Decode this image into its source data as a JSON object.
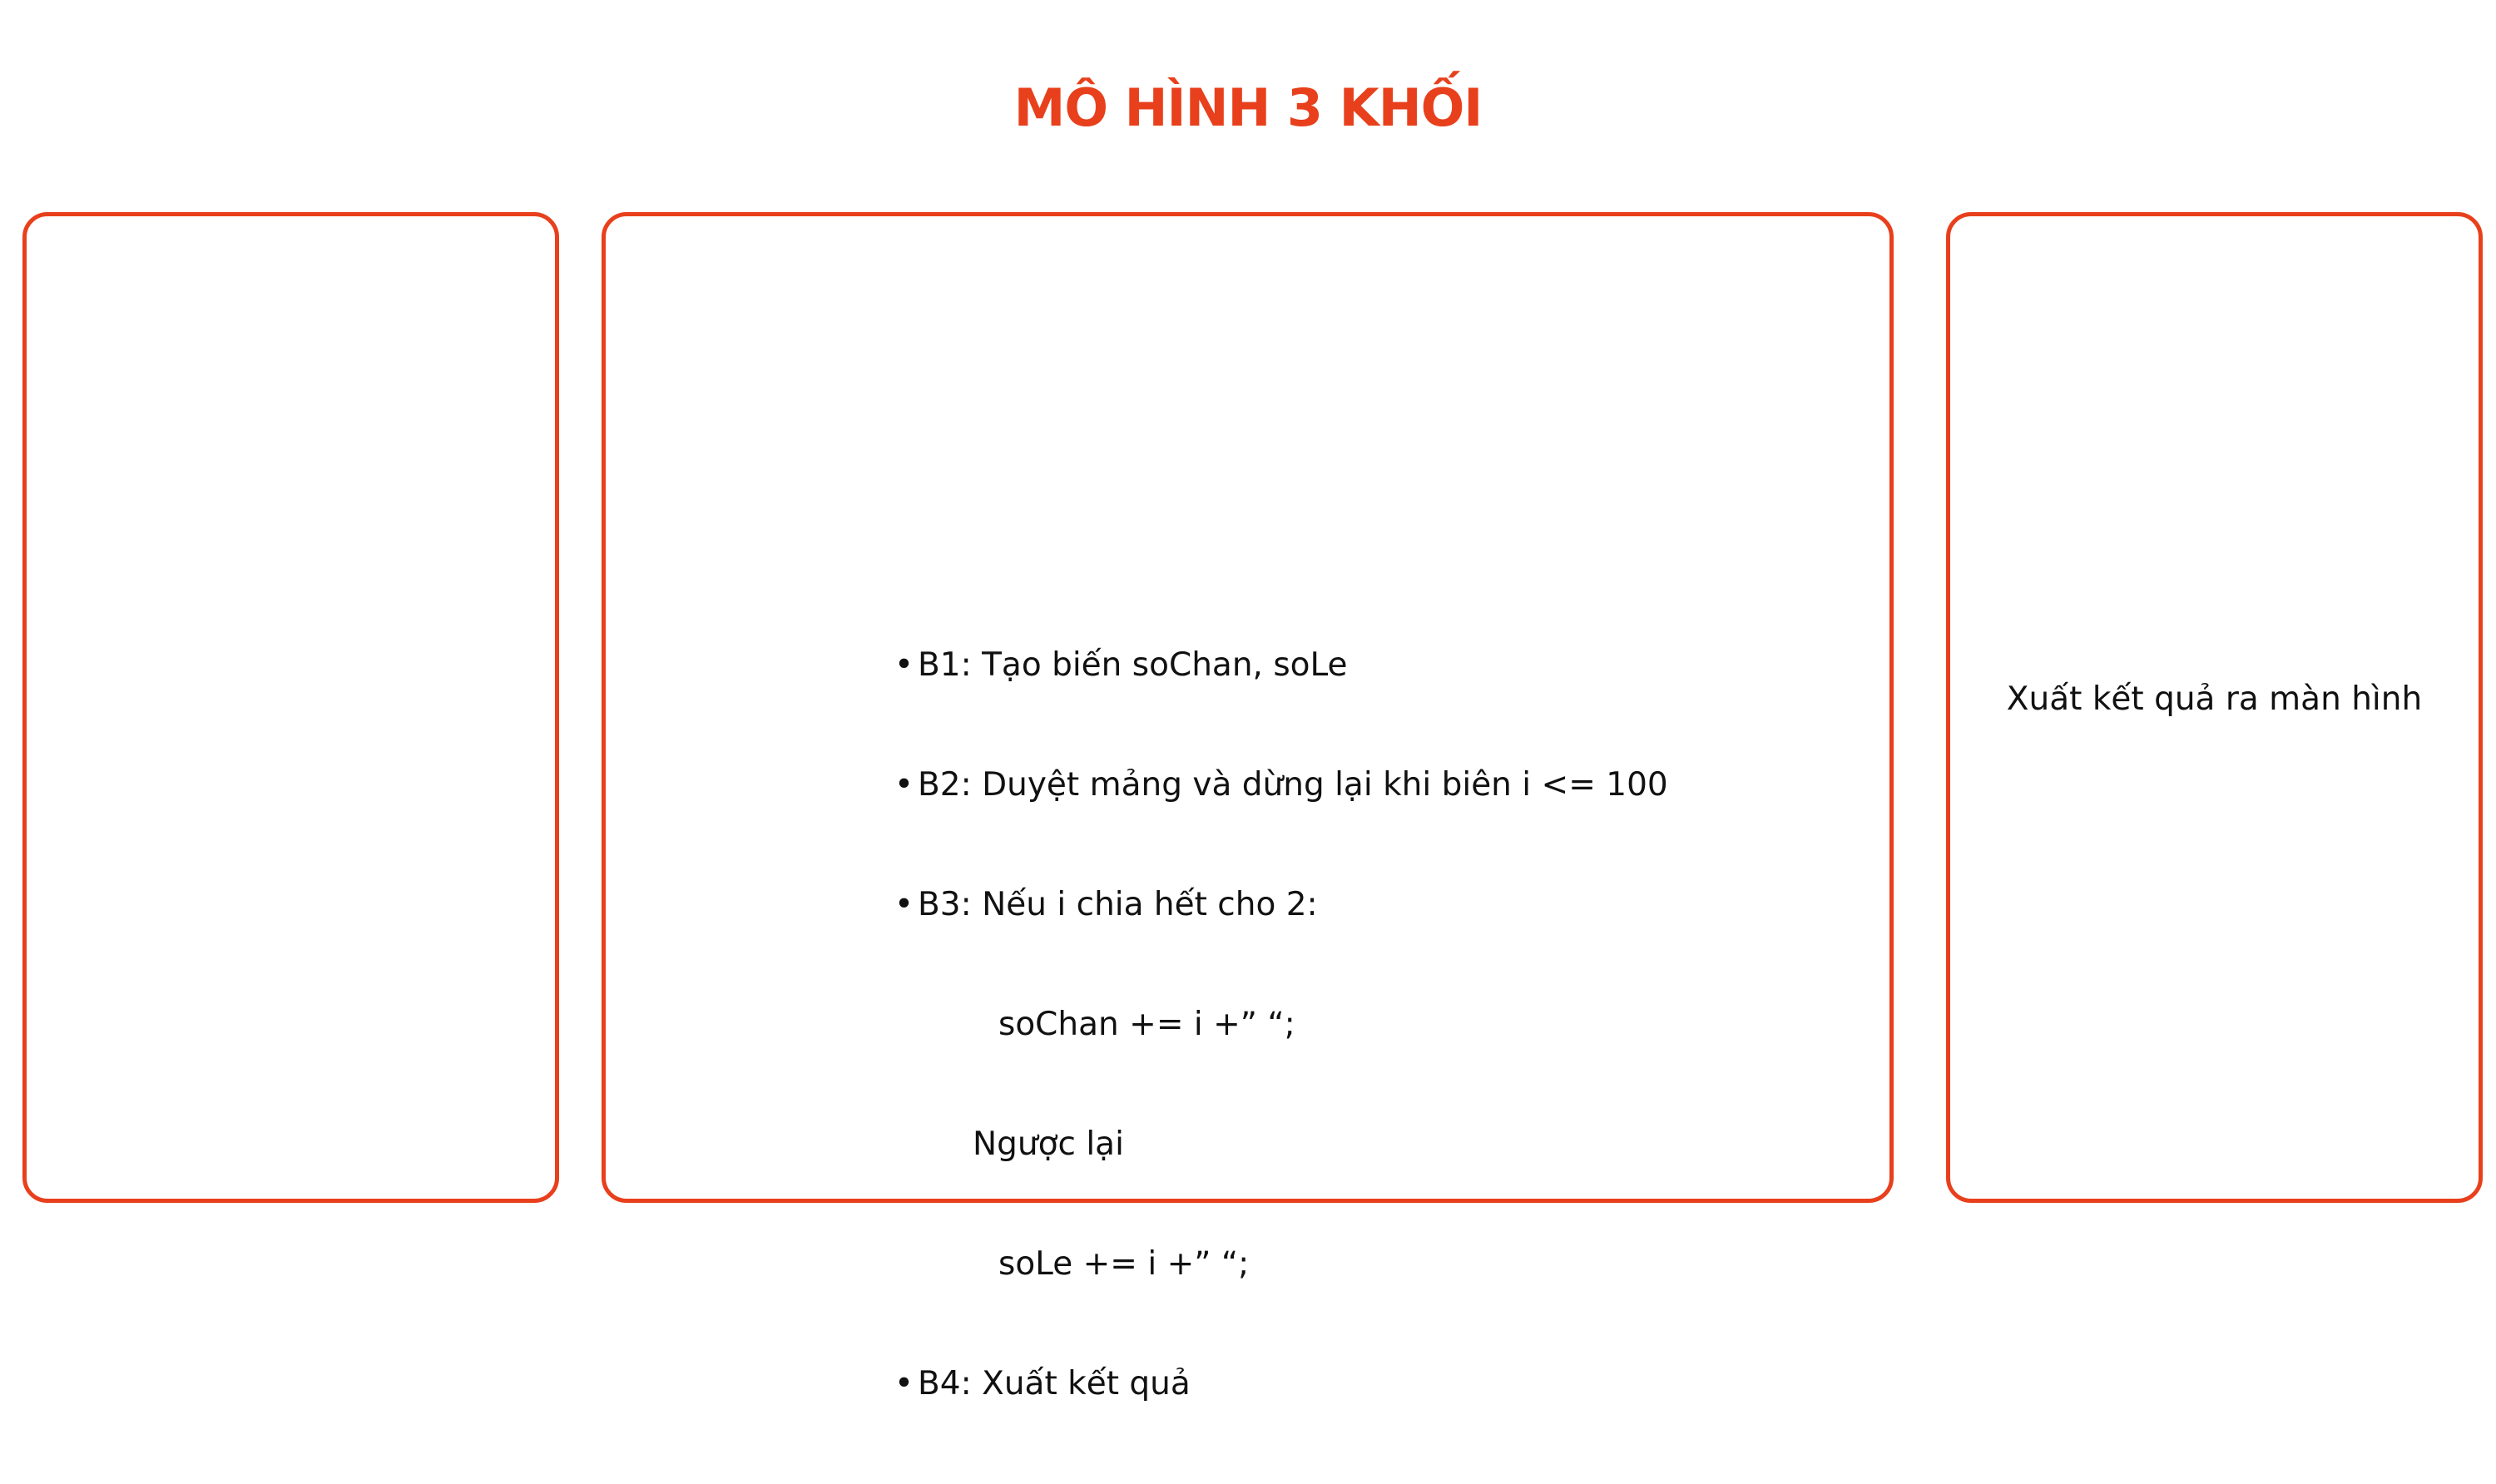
{
  "title": "MÔ HÌNH 3 KHỐI",
  "colors": {
    "accent": "#e8401c",
    "text": "#111111",
    "background": "#ffffff"
  },
  "blocks": {
    "input": {
      "lines": []
    },
    "process": {
      "lines": [
        {
          "bullet": true,
          "text": "B1: Tạo biến soChan, soLe"
        },
        {
          "bullet": true,
          "text": "B2: Duyệt mảng và dừng lại khi biên i <= 100"
        },
        {
          "bullet": true,
          "text": "B3: Nếu i chia hết cho 2:"
        },
        {
          "bullet": false,
          "text": "soChan += i +” “;"
        },
        {
          "bullet": false,
          "text": "Ngược lại"
        },
        {
          "bullet": false,
          "text": "soLe += i +” “;"
        },
        {
          "bullet": true,
          "text": "B4: Xuất kết quả"
        }
      ]
    },
    "output": {
      "text": "Xuất kết quả ra màn hình"
    }
  }
}
